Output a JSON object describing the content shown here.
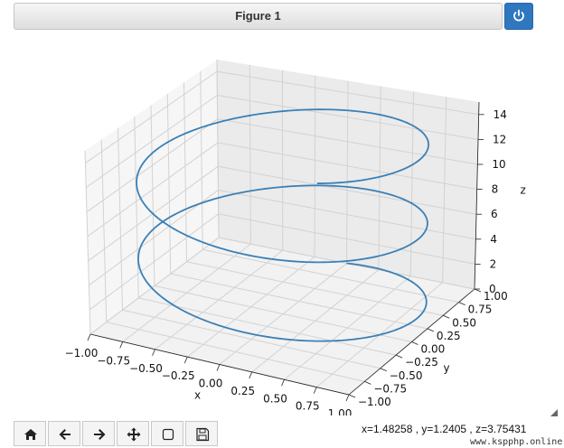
{
  "window": {
    "title": "Figure 1"
  },
  "icons": {
    "power": "power-icon",
    "resize": "resize-grip-icon"
  },
  "toolbar": {
    "buttons": [
      {
        "name": "home-button",
        "icon": "home-icon"
      },
      {
        "name": "back-button",
        "icon": "arrow-left-icon"
      },
      {
        "name": "forward-button",
        "icon": "arrow-right-icon"
      },
      {
        "name": "pan-button",
        "icon": "move-icon"
      },
      {
        "name": "zoom-button",
        "icon": "zoom-rect-icon"
      },
      {
        "name": "save-button",
        "icon": "save-icon"
      }
    ]
  },
  "status": {
    "coords": "x=1.48258 , y=1.2405 , z=3.75431"
  },
  "watermark": "www.kspphp.online",
  "colors": {
    "line": "#3b80b6",
    "accent": "#2f77bf"
  },
  "chart_data": {
    "type": "line",
    "projection": "3d",
    "series": [
      {
        "param": "t",
        "t_range": [
          0,
          15
        ],
        "x": "sin(t)",
        "y": "cos(t)",
        "z": "t",
        "points_sample": [
          [
            0,
            1,
            0
          ],
          [
            1,
            0,
            1.5708
          ],
          [
            0,
            -1,
            3.1416
          ],
          [
            -1,
            0,
            4.7124
          ],
          [
            0,
            1,
            6.2832
          ],
          [
            1,
            0,
            7.854
          ],
          [
            0,
            -1,
            9.4248
          ],
          [
            -1,
            0,
            10.9956
          ],
          [
            0,
            1,
            12.5664
          ],
          [
            0.65,
            -0.76,
            15
          ]
        ]
      }
    ],
    "xlabel": "x",
    "ylabel": "y",
    "zlabel": "z",
    "xlim": [
      -1.0,
      1.0
    ],
    "ylim": [
      -1.0,
      1.0
    ],
    "zlim": [
      0,
      15
    ],
    "xticks": [
      "−1.00",
      "−0.75",
      "−0.50",
      "−0.25",
      "0.00",
      "0.25",
      "0.50",
      "0.75",
      "1.00"
    ],
    "yticks": [
      "−1.00",
      "−0.75",
      "−0.50",
      "−0.25",
      "0.00",
      "0.25",
      "0.50",
      "0.75",
      "1.00"
    ],
    "zticks": [
      "0",
      "2",
      "4",
      "6",
      "8",
      "10",
      "12",
      "14"
    ],
    "grid": true
  }
}
